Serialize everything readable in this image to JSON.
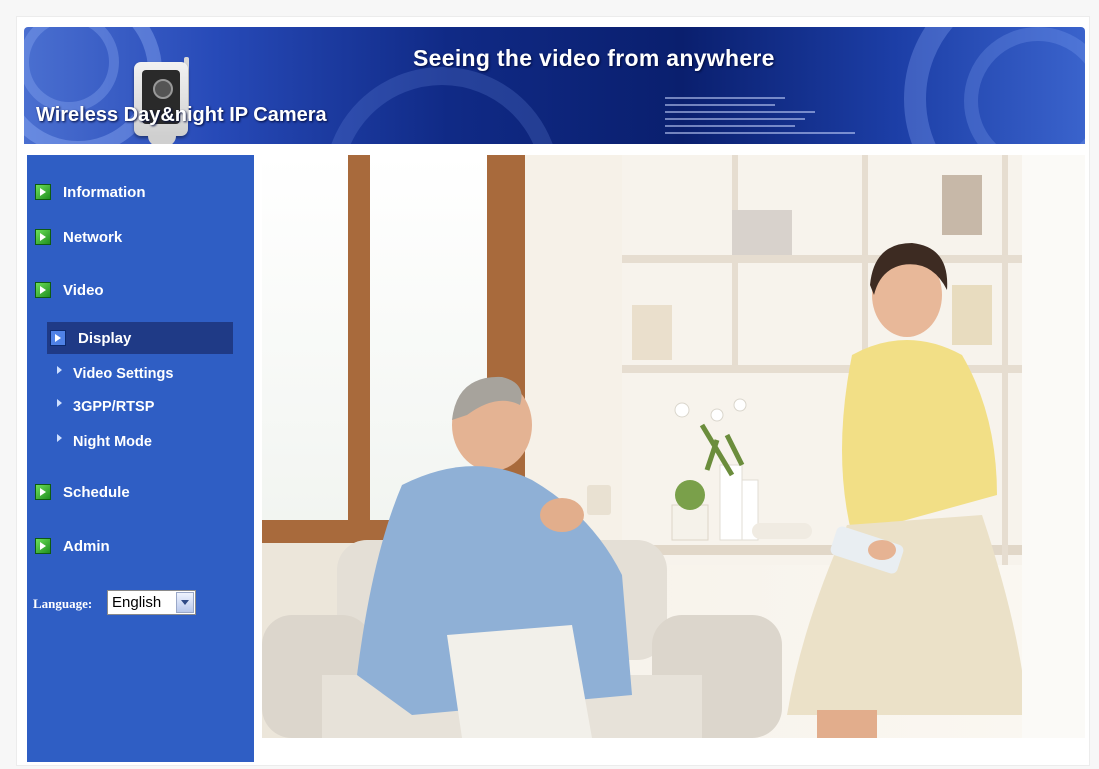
{
  "header": {
    "title": "Seeing the video from anywhere",
    "subtitle": "Wireless Day&night IP Camera"
  },
  "sidebar": {
    "items": [
      {
        "label": "Information",
        "icon": "green-play-icon"
      },
      {
        "label": "Network",
        "icon": "green-play-icon"
      },
      {
        "label": "Video",
        "icon": "green-play-icon"
      }
    ],
    "video_submenu": [
      {
        "label": "Display",
        "selected": true
      },
      {
        "label": "Video Settings"
      },
      {
        "label": "3GPP/RTSP"
      },
      {
        "label": "Night Mode"
      }
    ],
    "items_after": [
      {
        "label": "Schedule",
        "icon": "green-play-icon"
      },
      {
        "label": "Admin",
        "icon": "green-play-icon"
      }
    ],
    "language": {
      "label": "Language:",
      "value": "English"
    }
  },
  "colors": {
    "sidebar_bg": "#2f5ec4",
    "selected_bg": "#1f3a86",
    "header_dark": "#0a1f6e"
  }
}
